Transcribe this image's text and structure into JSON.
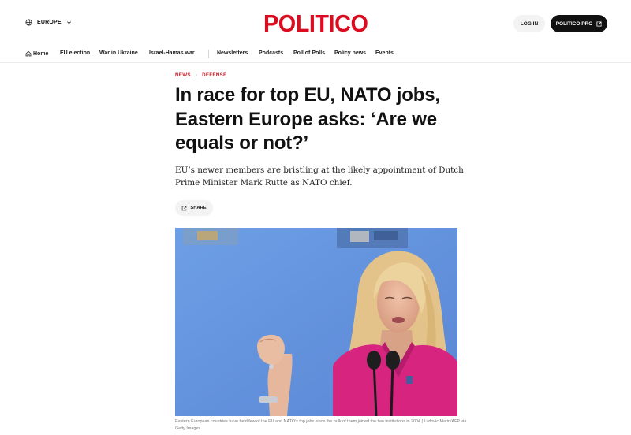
{
  "header": {
    "edition_label": "EUROPE",
    "logo": "POLITICO",
    "login_label": "LOG IN",
    "pro_label": "POLITICO PRO"
  },
  "nav": {
    "items": [
      "Home",
      "EU election",
      "War in Ukraine",
      "Israel-Hamas war",
      "Newsletters",
      "Podcasts",
      "Poll of Polls",
      "Policy news",
      "Events"
    ]
  },
  "article": {
    "breadcrumbs": [
      "NEWS",
      "DEFENSE"
    ],
    "breadcrumb_separator": "›",
    "headline": "In race for top EU, NATO jobs, Eastern Europe asks: ‘Are we equals or not?’",
    "dek": "EU’s newer members are bristling at the likely appointment of Dutch Prime Minister Mark Rutte as NATO chief.",
    "share_label": "SHARE",
    "caption": "Eastern European countries have held few of the EU and NATO’s top jobs since the bulk of them joined the two institutions in 2004 | Ludovic Marin/AFP via Getty Images"
  },
  "colors": {
    "brand": "#dc0c20",
    "breadcrumb": "#c81a28",
    "photo_background": "#6f9be0",
    "jacket": "#d6247f"
  },
  "icons": [
    "globe-icon",
    "chevron-down-icon",
    "external-link-icon",
    "home-icon",
    "share-icon"
  ]
}
